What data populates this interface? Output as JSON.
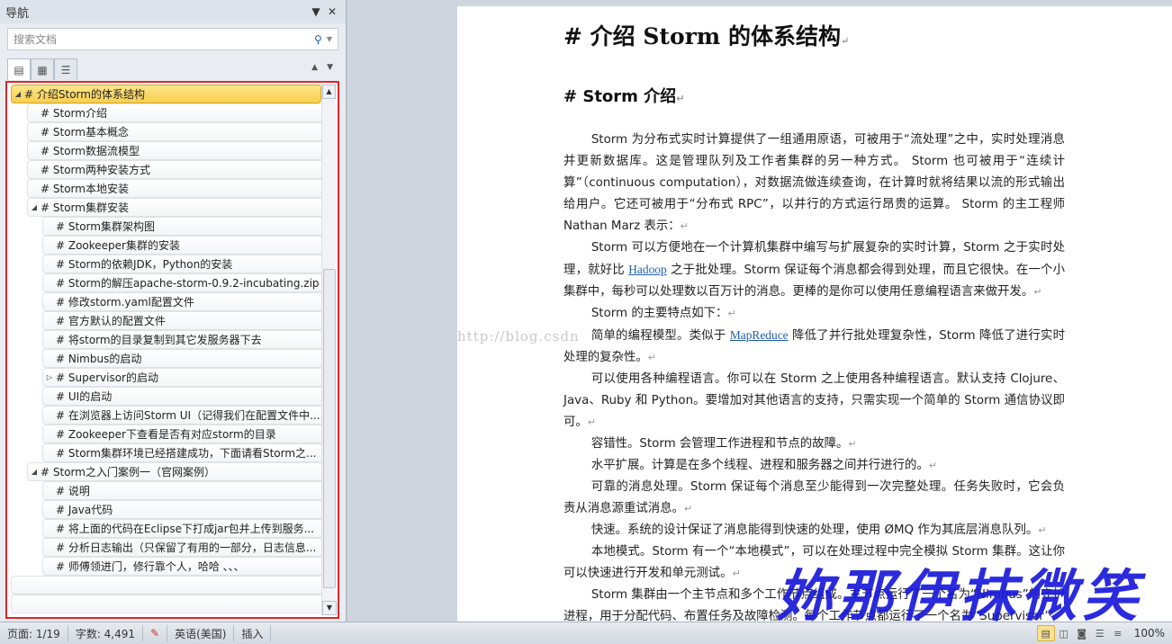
{
  "nav": {
    "title": "导航",
    "search_placeholder": "搜索文档",
    "tree": [
      {
        "label": "# 介绍Storm的体系结构",
        "level": 1,
        "toggle": "◢",
        "selected": true
      },
      {
        "label": "# Storm介绍",
        "level": 2
      },
      {
        "label": "# Storm基本概念",
        "level": 2
      },
      {
        "label": "# Storm数据流模型",
        "level": 2
      },
      {
        "label": "# Storm两种安装方式",
        "level": 2
      },
      {
        "label": "# Storm本地安装",
        "level": 2
      },
      {
        "label": "# Storm集群安装",
        "level": 2,
        "toggle": "◢"
      },
      {
        "label": "# Storm集群架构图",
        "level": 3
      },
      {
        "label": "# Zookeeper集群的安装",
        "level": 3
      },
      {
        "label": "# Storm的依赖JDK，Python的安装",
        "level": 3
      },
      {
        "label": "# Storm的解压apache-storm-0.9.2-incubating.zip",
        "level": 3
      },
      {
        "label": "# 修改storm.yaml配置文件",
        "level": 3
      },
      {
        "label": "# 官方默认的配置文件",
        "level": 3
      },
      {
        "label": "# 将storm的目录复制到其它发服务器下去",
        "level": 3
      },
      {
        "label": "# Nimbus的启动",
        "level": 3
      },
      {
        "label": "# Supervisor的启动",
        "level": 3,
        "toggle": "▷"
      },
      {
        "label": "# UI的启动",
        "level": 3
      },
      {
        "label": "# 在浏览器上访问Storm UI（记得我们在配置文件中...",
        "level": 3
      },
      {
        "label": "# Zookeeper下查看是否有对应storm的目录",
        "level": 3
      },
      {
        "label": "# Storm集群环境已经搭建成功，下面请看Storm之...",
        "level": 3
      },
      {
        "label": "# Storm之入门案例一（官网案例）",
        "level": 2,
        "toggle": "◢"
      },
      {
        "label": "# 说明",
        "level": 3
      },
      {
        "label": "# Java代码",
        "level": 3
      },
      {
        "label": "# 将上面的代码在Eclipse下打成jar包并上传到服务...",
        "level": 3
      },
      {
        "label": "# 分析日志输出（只保留了有用的一部分，日志信息...",
        "level": 3
      },
      {
        "label": "#  师傅领进门，修行靠个人，哈哈 、、、",
        "level": 3
      }
    ]
  },
  "doc": {
    "h1": "# 介绍 Storm 的体系结构",
    "h2": "# Storm 介绍",
    "p1": "Storm 为分布式实时计算提供了一组通用原语，可被用于“流处理”之中，实时处理消息并更新数据库。这是管理队列及工作者集群的另一种方式。 Storm 也可被用于“连续计算”（continuous computation），对数据流做连续查询，在计算时就将结果以流的形式输出给用户。它还可被用于“分布式 RPC”，以并行的方式运行昂贵的运算。 Storm 的主工程师 Nathan Marz 表示：",
    "p2a": "Storm 可以方便地在一个计算机集群中编写与扩展复杂的实时计算，Storm 之于实时处理，就好比 ",
    "hadoop": "Hadoop",
    "p2b": " 之于批处理。Storm 保证每个消息都会得到处理，而且它很快。在一个小集群中，每秒可以处理数以百万计的消息。更棒的是你可以使用任意编程语言来做开发。",
    "p3": "Storm 的主要特点如下：",
    "p4a": "简单的编程模型。类似于 ",
    "mapreduce": "MapReduce",
    "p4b": " 降低了并行批处理复杂性，Storm 降低了进行实时处理的复杂性。",
    "p5": "可以使用各种编程语言。你可以在 Storm 之上使用各种编程语言。默认支持 Clojure、Java、Ruby 和 Python。要增加对其他语言的支持，只需实现一个简单的 Storm 通信协议即可。",
    "p6": "容错性。Storm 会管理工作进程和节点的故障。",
    "p7": "水平扩展。计算是在多个线程、进程和服务器之间并行进行的。",
    "p8": "可靠的消息处理。Storm 保证每个消息至少能得到一次完整处理。任务失败时，它会负责从消息源重试消息。",
    "p9": "快速。系统的设计保证了消息能得到快速的处理，使用 ØMQ 作为其底层消息队列。",
    "p10": "本地模式。Storm 有一个“本地模式”，可以在处理过程中完全模拟 Storm 集群。这让你可以快速进行开发和单元测试。",
    "p11": "Storm 集群由一个主节点和多个工作节点组成。主节点运行了一个名为“Nimbus”的守护进程，用于分配代码、布置任务及故障检测。每个工作节点都运行了一个名为“Supervisor”",
    "para_mark": "↵",
    "wm_url": "http://blog.csdn",
    "wm_sign": "妳那伊抹微笑"
  },
  "status": {
    "page": "页面: 1/19",
    "words": "字数: 4,491",
    "lang": "英语(美国)",
    "mode": "插入",
    "zoom": "100%"
  }
}
